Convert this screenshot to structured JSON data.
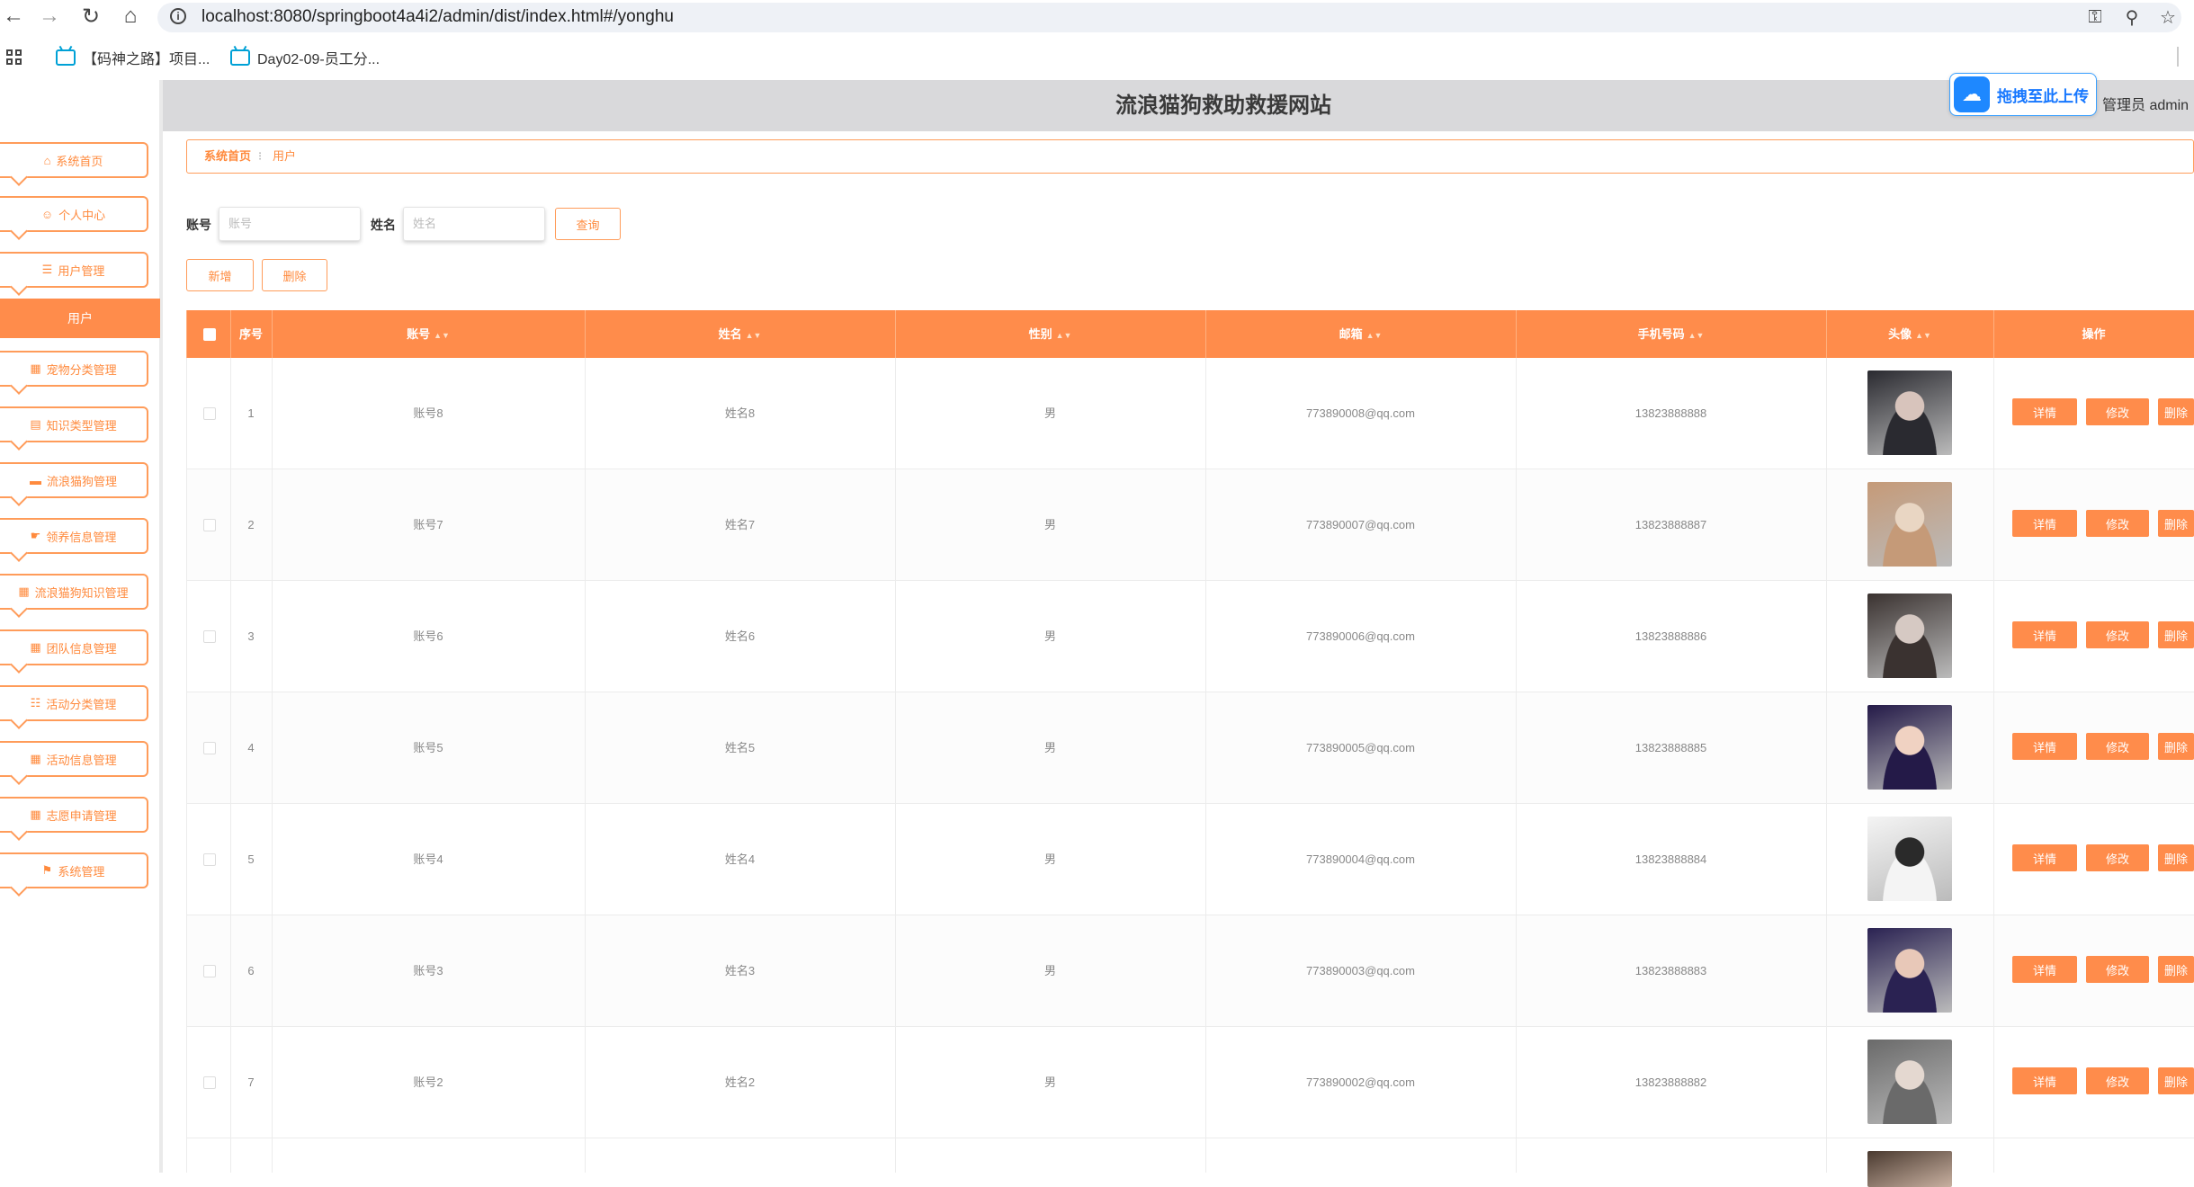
{
  "browser": {
    "url": "localhost:8080/springboot4a4i2/admin/dist/index.html#/yonghu",
    "bookmarks": [
      {
        "label": "【码神之路】项目..."
      },
      {
        "label": "Day02-09-员工分..."
      }
    ]
  },
  "header": {
    "title": "流浪猫狗救助救援网站",
    "admin_label": "管理员 admin",
    "upload_label": "拖拽至此上传"
  },
  "sidebar": {
    "items": [
      {
        "label": "系统首页",
        "icon": "home-icon"
      },
      {
        "label": "个人中心",
        "icon": "user-icon"
      },
      {
        "label": "用户管理",
        "icon": "list-icon"
      },
      {
        "label": "宠物分类管理",
        "icon": "grid-icon"
      },
      {
        "label": "知识类型管理",
        "icon": "doc-icon"
      },
      {
        "label": "流浪猫狗管理",
        "icon": "monitor-icon"
      },
      {
        "label": "领养信息管理",
        "icon": "hand-icon"
      },
      {
        "label": "流浪猫狗知识管理",
        "icon": "grid-icon"
      },
      {
        "label": "团队信息管理",
        "icon": "grid-icon"
      },
      {
        "label": "活动分类管理",
        "icon": "apps-icon"
      },
      {
        "label": "活动信息管理",
        "icon": "grid-icon"
      },
      {
        "label": "志愿申请管理",
        "icon": "grid-icon"
      },
      {
        "label": "系统管理",
        "icon": "trophy-icon"
      }
    ],
    "active_submenu": "用户"
  },
  "breadcrumb": {
    "home": "系统首页",
    "current": "用户"
  },
  "search": {
    "account_label": "账号",
    "account_placeholder": "账号",
    "name_label": "姓名",
    "name_placeholder": "姓名",
    "query_button": "查询"
  },
  "toolbar": {
    "add_button": "新增",
    "delete_button": "删除"
  },
  "table": {
    "headers": {
      "index": "序号",
      "account": "账号",
      "name": "姓名",
      "gender": "性别",
      "email": "邮箱",
      "phone": "手机号码",
      "avatar": "头像",
      "actions": "操作"
    },
    "action_labels": {
      "detail": "详情",
      "edit": "修改",
      "delete": "删除"
    },
    "rows": [
      {
        "index": "1",
        "account": "账号8",
        "name": "姓名8",
        "gender": "男",
        "email": "773890008@qq.com",
        "phone": "13823888888"
      },
      {
        "index": "2",
        "account": "账号7",
        "name": "姓名7",
        "gender": "男",
        "email": "773890007@qq.com",
        "phone": "13823888887"
      },
      {
        "index": "3",
        "account": "账号6",
        "name": "姓名6",
        "gender": "男",
        "email": "773890006@qq.com",
        "phone": "13823888886"
      },
      {
        "index": "4",
        "account": "账号5",
        "name": "姓名5",
        "gender": "男",
        "email": "773890005@qq.com",
        "phone": "13823888885"
      },
      {
        "index": "5",
        "account": "账号4",
        "name": "姓名4",
        "gender": "男",
        "email": "773890004@qq.com",
        "phone": "13823888884"
      },
      {
        "index": "6",
        "account": "账号3",
        "name": "姓名3",
        "gender": "男",
        "email": "773890003@qq.com",
        "phone": "13823888883"
      },
      {
        "index": "7",
        "account": "账号2",
        "name": "姓名2",
        "gender": "男",
        "email": "773890002@qq.com",
        "phone": "13823888882"
      }
    ]
  },
  "colors": {
    "accent": "#ff8c4b",
    "header_bg": "#d9d9db",
    "link_blue": "#1677ff"
  }
}
